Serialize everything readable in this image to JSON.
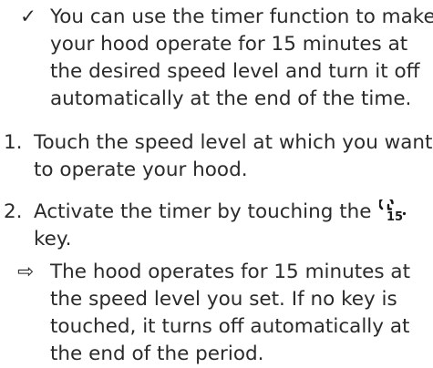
{
  "note": {
    "marker": "✓",
    "lines": [
      "You can use the timer function to make",
      "your hood operate for 15 minutes at",
      "the desired speed level and turn it off",
      "automatically at the end of the time."
    ]
  },
  "steps": [
    {
      "number": "1.",
      "lines": [
        "Touch the speed level at which you want",
        "to operate your hood."
      ]
    },
    {
      "number": "2.",
      "lines": [
        "Activate the timer by touching the",
        "key."
      ],
      "key_icon": "timer-15-minute-key-icon",
      "key_icon_text": "15"
    }
  ],
  "result": {
    "marker": "⇨",
    "lines": [
      "The hood operates for 15 minutes at",
      "the speed level you set. If no key is",
      "touched, it turns off automatically at",
      "the end of the period."
    ]
  }
}
